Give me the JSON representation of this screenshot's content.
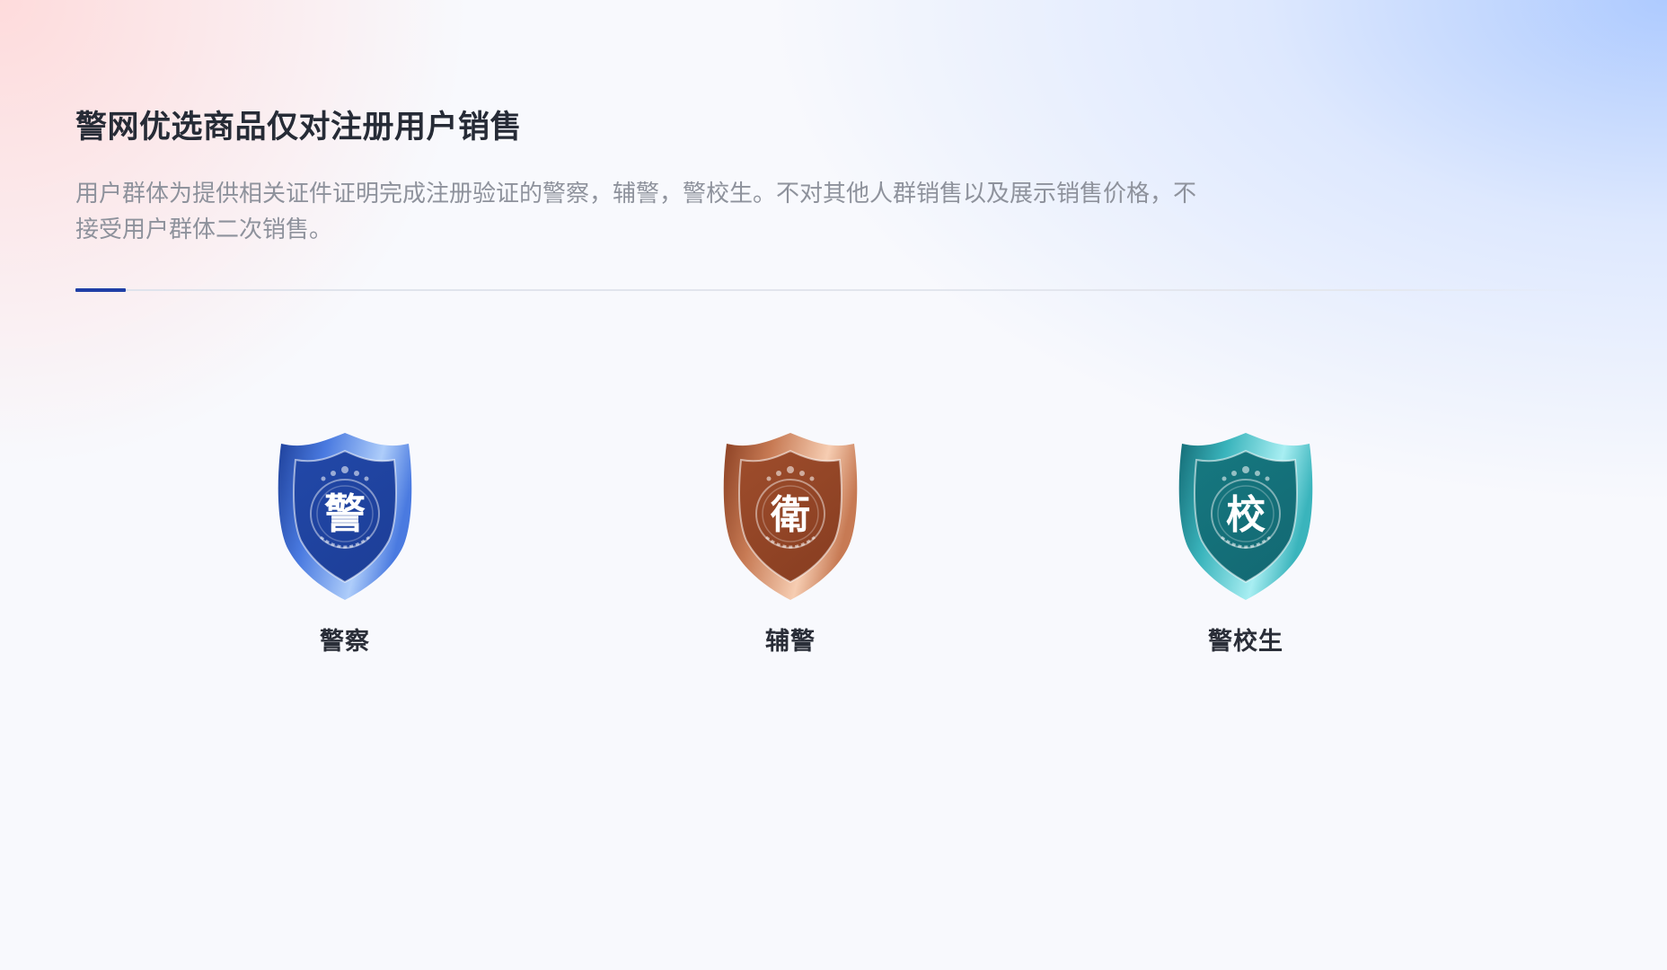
{
  "header": {
    "title": "警网优选商品仅对注册用户销售",
    "description": "用户群体为提供相关证件证明完成注册验证的警察，辅警，警校生。不对其他人群销售以及展示销售价格，不接受用户群体二次销售。"
  },
  "badges": [
    {
      "label": "警察",
      "glyph": "警",
      "icon": "police-shield-icon",
      "colors": {
        "light": "#aecdfa",
        "mid": "#4a7ae0",
        "dark": "#1d3f99",
        "inner": "#2248a8"
      }
    },
    {
      "label": "辅警",
      "glyph": "衛",
      "icon": "auxiliary-police-shield-icon",
      "colors": {
        "light": "#f6cdb2",
        "mid": "#c77a54",
        "dark": "#8a3f22",
        "inner": "#9e4d2c"
      }
    },
    {
      "label": "警校生",
      "glyph": "校",
      "icon": "police-cadet-shield-icon",
      "colors": {
        "light": "#a8eef2",
        "mid": "#3ab4bc",
        "dark": "#136a74",
        "inner": "#167880"
      }
    }
  ],
  "theme": {
    "accent": "#1f3fa6",
    "title_color": "#262b36",
    "description_color": "#8e929c"
  }
}
